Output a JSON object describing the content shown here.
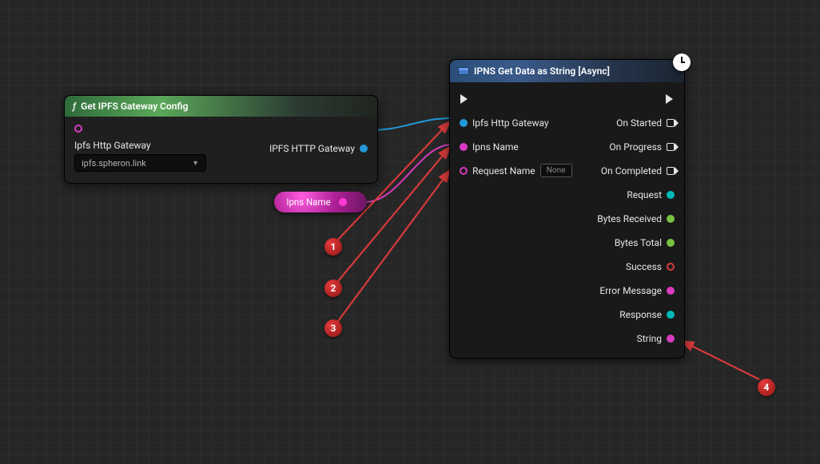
{
  "cfg_node": {
    "title": "Get IPFS Gateway Config",
    "in_label": "Ipfs Http Gateway",
    "dropdown_value": "ipfs.spheron.link",
    "out_label": "IPFS HTTP Gateway"
  },
  "var_node": {
    "label": "Ipns Name"
  },
  "async_node": {
    "title": "IPNS Get Data as String [Async]",
    "inputs": {
      "gateway": "Ipfs Http Gateway",
      "ipns": "Ipns Name",
      "reqname_label": "Request Name",
      "reqname_value": "None"
    },
    "outputs": {
      "started": "On Started",
      "progress": "On Progress",
      "completed": "On Completed",
      "request": "Request",
      "bytes_recv": "Bytes Received",
      "bytes_total": "Bytes Total",
      "success": "Success",
      "error": "Error Message",
      "response": "Response",
      "string": "String"
    }
  },
  "markers": {
    "m1": "1",
    "m2": "2",
    "m3": "3",
    "m4": "4"
  }
}
